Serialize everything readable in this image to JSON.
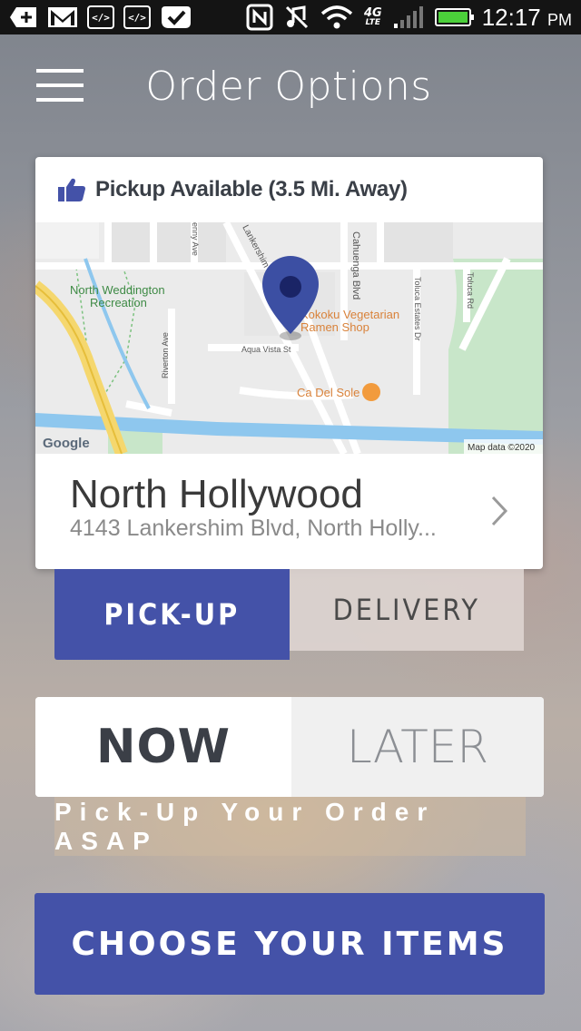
{
  "status_bar": {
    "time": "12:17",
    "am_pm": "PM",
    "network_label_top": "4G",
    "network_label_bottom": "LTE",
    "icons": [
      "add-icon",
      "gmail-icon",
      "code-icon",
      "code-icon",
      "check-app-icon",
      "nfc-icon",
      "mute-icon",
      "wifi-icon",
      "signal-icon",
      "battery-charging-icon"
    ]
  },
  "header": {
    "title": "Order Options",
    "menu_icon": "hamburger-menu-icon"
  },
  "pickup_card": {
    "availability": "Pickup Available (3.5 Mi. Away)",
    "availability_icon": "thumbs-up-icon",
    "map": {
      "labels": {
        "park": "North Weddington",
        "park2": "Recreation",
        "restaurant1": "Kokoku Vegetarian",
        "restaurant1b": "Ramen Shop",
        "restaurant2": "Ca Del Sole",
        "street1": "Aqua Vista St",
        "street2": "Cahuenga Blvd",
        "street3": "Toluca Estates Dr",
        "street4": "Toluca Rd",
        "street5": "Riverton Ave",
        "street6": "Lankershim",
        "street7": "enny Ave",
        "google": "Google",
        "map_data": "Map data ©2020"
      },
      "pin_icon": "location-pin-icon"
    },
    "location_name": "North Hollywood",
    "location_address": "4143 Lankershim Blvd, North Holly...",
    "chevron_icon": "chevron-right-icon"
  },
  "fulfillment": {
    "pickup_label": "PICK-UP",
    "delivery_label": "DELIVERY",
    "selected": "PICK-UP"
  },
  "timing": {
    "now_label": "NOW",
    "later_label": "LATER",
    "selected": "NOW",
    "note": "Pick-Up Your Order ASAP"
  },
  "cta": {
    "label": "CHOOSE YOUR ITEMS"
  },
  "colors": {
    "accent": "#4452a8",
    "map_pin": "#3c4fa3",
    "status_bar": "#141414"
  }
}
